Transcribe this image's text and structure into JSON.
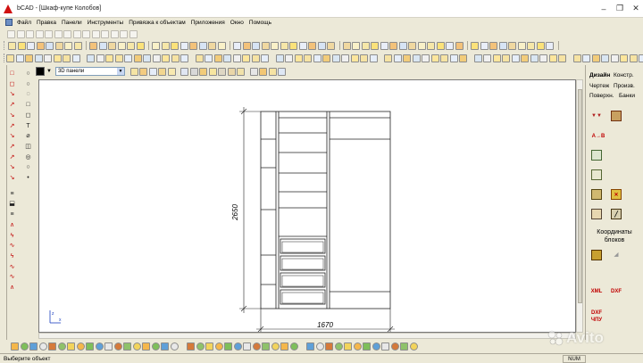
{
  "window": {
    "title": "bCAD - [Шкаф-купе Колобов]"
  },
  "menu": [
    "Файл",
    "Правка",
    "Панели",
    "Инструменты",
    "Привязка к объектам",
    "Приложения",
    "Окно",
    "Помощь"
  ],
  "properties_bar": {
    "color": "#000000",
    "view_combo_value": "3D панели"
  },
  "drawing": {
    "height_dimension": "2650",
    "width_dimension": "1670",
    "axis_z_label": "z",
    "axis_x_label": "x"
  },
  "right_panel": {
    "tabs": [
      "Дизайн",
      "Констр.",
      "Чертеж",
      "Произв.",
      "Поверхн.",
      "Банки"
    ],
    "active_tab": "Дизайн",
    "icon_ab": "A→B",
    "coords_label_1": "Координаты",
    "coords_label_2": "блоков",
    "xml_label": "XML",
    "dxf_label": "DXF",
    "dxf_label_2": "DXF",
    "chpu_label": "ЧПУ"
  },
  "status": {
    "message": "Выберите объект",
    "num_indicator": "NUM"
  },
  "watermark": {
    "text": "Avito"
  },
  "colors": {
    "accent_red": "#c00000",
    "selection_blue": "#316ac5"
  }
}
